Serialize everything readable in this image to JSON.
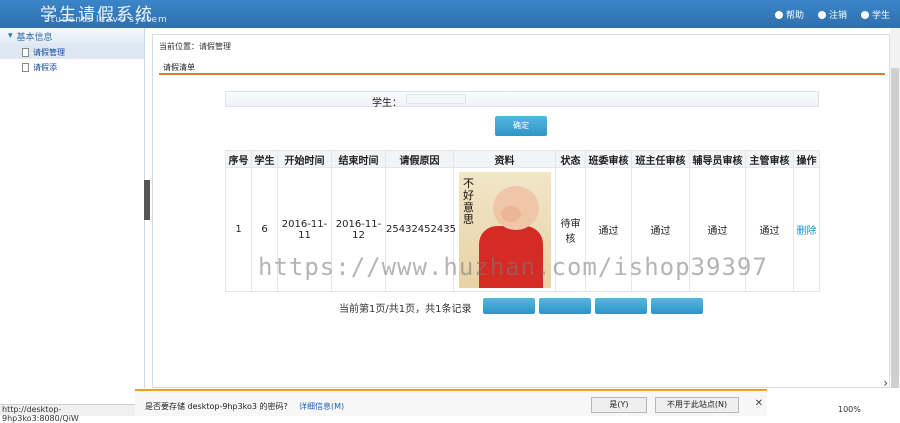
{
  "header": {
    "title": "学生请假系统",
    "subtitle": "Students leave system",
    "links": [
      {
        "icon": "help-icon",
        "label": "帮助"
      },
      {
        "icon": "logout-icon",
        "label": "注销"
      },
      {
        "icon": "user-icon",
        "label": "学生"
      }
    ]
  },
  "sidebar": {
    "section": "基本信息",
    "items": [
      {
        "label": "请假管理",
        "active": true
      },
      {
        "label": "请假添"
      }
    ]
  },
  "main": {
    "breadcrumb": "当前位置：请假管理",
    "tab": "请假清单",
    "search_label": "学生：",
    "search_value": "",
    "confirm_label": "确定",
    "table": {
      "headers": [
        "序号",
        "学生",
        "开始时间",
        "结束时间",
        "请假原因",
        "资料",
        "状态",
        "班委审核",
        "班主任审核",
        "辅导员审核",
        "主管审核",
        "操作"
      ],
      "row": {
        "index": "1",
        "student": "6",
        "start": "2016-11-11",
        "end": "2016-11-12",
        "reason": "25432452435",
        "photo_caption": "不好意思",
        "status": "待审核",
        "class_committee": "通过",
        "head_teacher": "通过",
        "counselor": "通过",
        "supervisor": "通过",
        "action": "删除"
      }
    },
    "pager": "当前第1页/共1页，共1条记录"
  },
  "watermark": "https://www.huzhan.com/ishop39397",
  "download_bar": {
    "prompt": "是否要存储 desktop-9hp3ko3 的密码?",
    "details_link": "详细信息(M)",
    "yes_button": "是(Y)",
    "never_button": "不用于此站点(N)"
  },
  "statusbar": {
    "url": "http://desktop-9hp3ko3:8080/QiW",
    "zoom": "100%"
  },
  "colors": {
    "header": "#2f6fae",
    "accent": "#e07d2b",
    "button": "#3aa2d1"
  }
}
